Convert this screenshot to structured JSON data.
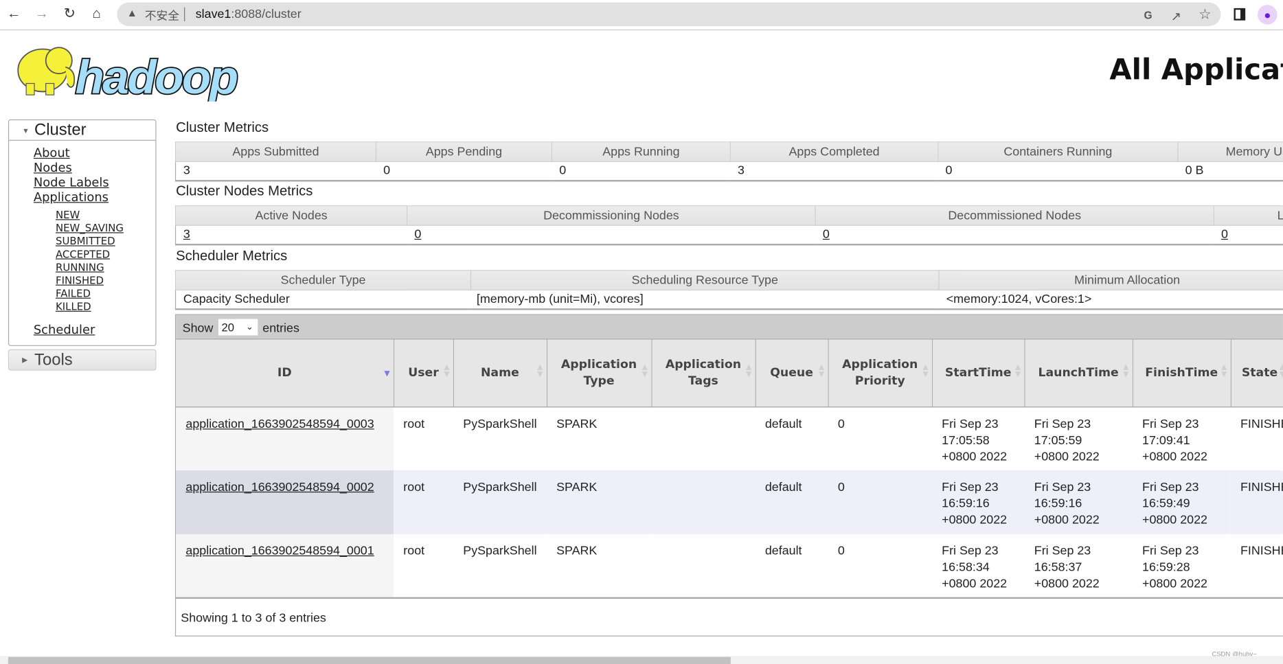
{
  "browser": {
    "security_label": "不安全",
    "url_host": "slave1",
    "url_rest": ":8088/cluster"
  },
  "header": {
    "logo_text": "hadoop",
    "title": "All Applications"
  },
  "sidebar": {
    "cluster_label": "Cluster",
    "links": [
      "About",
      "Nodes",
      "Node Labels",
      "Applications"
    ],
    "app_states": [
      "NEW",
      "NEW_SAVING",
      "SUBMITTED",
      "ACCEPTED",
      "RUNNING",
      "FINISHED",
      "FAILED",
      "KILLED"
    ],
    "scheduler_label": "Scheduler",
    "tools_label": "Tools"
  },
  "cluster_metrics": {
    "title": "Cluster Metrics",
    "headers": [
      "Apps Submitted",
      "Apps Pending",
      "Apps Running",
      "Apps Completed",
      "Containers Running",
      "Memory Used"
    ],
    "values": [
      "3",
      "0",
      "0",
      "3",
      "0",
      "0 B"
    ]
  },
  "nodes_metrics": {
    "title": "Cluster Nodes Metrics",
    "headers": [
      "Active Nodes",
      "Decommissioning Nodes",
      "Decommissioned Nodes",
      "Lost Nodes"
    ],
    "values": [
      "3",
      "0",
      "0",
      "0"
    ]
  },
  "scheduler_metrics": {
    "title": "Scheduler Metrics",
    "headers": [
      "Scheduler Type",
      "Scheduling Resource Type",
      "Minimum Allocation"
    ],
    "values": [
      "Capacity Scheduler",
      "[memory-mb (unit=Mi), vcores]",
      "<memory:1024, vCores:1>"
    ]
  },
  "apps_table": {
    "show_label": "Show",
    "page_length": "20",
    "entries_label": "entries",
    "sorted_column": "ID",
    "columns": [
      "ID",
      "User",
      "Name",
      "Application Type",
      "Application Tags",
      "Queue",
      "Application Priority",
      "StartTime",
      "LaunchTime",
      "FinishTime",
      "State"
    ],
    "rows": [
      [
        "application_1663902548594_0003",
        "root",
        "PySparkShell",
        "SPARK",
        "",
        "default",
        "0",
        "Fri Sep 23 17:05:58 +0800 2022",
        "Fri Sep 23 17:05:59 +0800 2022",
        "Fri Sep 23 17:09:41 +0800 2022",
        "FINISHED"
      ],
      [
        "application_1663902548594_0002",
        "root",
        "PySparkShell",
        "SPARK",
        "",
        "default",
        "0",
        "Fri Sep 23 16:59:16 +0800 2022",
        "Fri Sep 23 16:59:16 +0800 2022",
        "Fri Sep 23 16:59:49 +0800 2022",
        "FINISHED"
      ],
      [
        "application_1663902548594_0001",
        "root",
        "PySparkShell",
        "SPARK",
        "",
        "default",
        "0",
        "Fri Sep 23 16:58:34 +0800 2022",
        "Fri Sep 23 16:58:37 +0800 2022",
        "Fri Sep 23 16:59:28 +0800 2022",
        "FINISHED"
      ]
    ],
    "info": "Showing 1 to 3 of 3 entries"
  },
  "watermark": "CSDN @huhy~"
}
